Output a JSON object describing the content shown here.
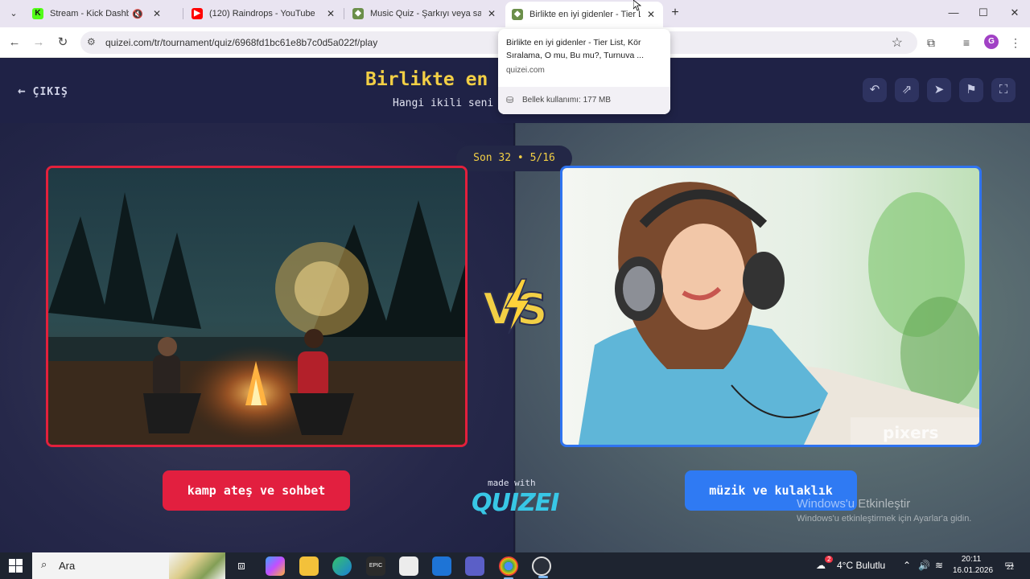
{
  "browser": {
    "tabs": [
      {
        "title": "Stream - Kick Dashboard",
        "favicon": "kick-icon",
        "color": "#53fc18"
      },
      {
        "title": "(120) Raindrops - YouTube",
        "favicon": "youtube-icon",
        "color": "#ff0000"
      },
      {
        "title": "Music Quiz - Şarkıyı veya sanatçı",
        "favicon": "quizei-icon",
        "color": "#6b8f4a"
      },
      {
        "title": "Birlikte en iyi gidenler - Tier List",
        "favicon": "quizei-icon",
        "color": "#6b8f4a"
      }
    ],
    "url": "quizei.com/tr/tournament/quiz/6968fd1bc61e8b7c0d5a022f/play",
    "profile_initial": "G"
  },
  "tooltip": {
    "title": "Birlikte en iyi gidenler - Tier List, Kör Sıralama, O mu, Bu mu?, Turnuva ...",
    "domain": "quizei.com",
    "memory": "Bellek kullanımı: 177 MB"
  },
  "page": {
    "exit_label": "ÇIKIŞ",
    "title": "Birlikte en",
    "subtitle": "Hangi ikili seni",
    "progress": "Son 32 • 5/16",
    "left_choice": "kamp ateş ve sohbet",
    "right_choice": "müzik ve kulaklık",
    "made_with": "made with",
    "logo": "QUIZEI",
    "watermark_image": "pixers",
    "colors": {
      "accent": "#f2cf45",
      "left": "#e21f3f",
      "right": "#2f7af3"
    }
  },
  "os_watermark": {
    "line1": "Windows'u Etkinleştir",
    "line2": "Windows'u etkinleştirmek için Ayarlar'a gidin."
  },
  "taskbar": {
    "search_placeholder": "Ara",
    "weather": "4°C Bulutlu",
    "weather_badge": "2",
    "time": "20:11",
    "date": "16.01.2026",
    "notifications": "22"
  }
}
